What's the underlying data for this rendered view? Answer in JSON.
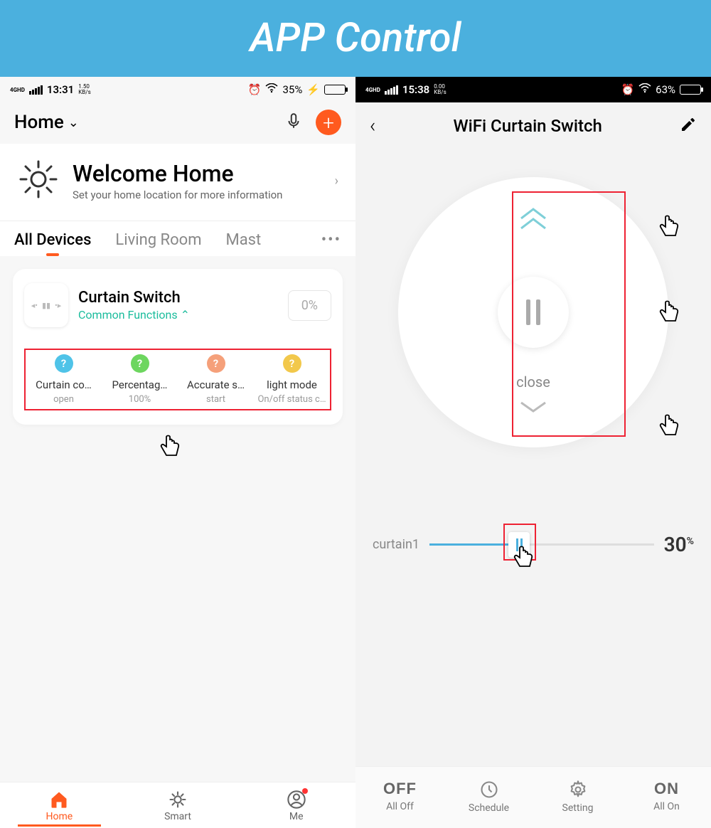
{
  "banner": "APP Control",
  "left": {
    "status": {
      "net": "4GHD",
      "time": "13:31",
      "kb": "1.50",
      "kbu": "KB/s",
      "battery_pct": "35%",
      "battery_fill": 35
    },
    "header": {
      "home": "Home",
      "chevron": "⌄"
    },
    "weather": {
      "title": "Welcome Home",
      "sub": "Set your home location for more information"
    },
    "tabs": {
      "t1": "All Devices",
      "t2": "Living Room",
      "t3": "Mast"
    },
    "card": {
      "title": "Curtain Switch",
      "cf": "Common Functions",
      "pct": "0%",
      "funcs": [
        {
          "label": "Curtain co…",
          "sub": "open",
          "color": "#4fc3e8"
        },
        {
          "label": "Percentag…",
          "sub": "100%",
          "color": "#6dd65f"
        },
        {
          "label": "Accurate s…",
          "sub": "start",
          "color": "#f5a07a"
        },
        {
          "label": "light mode",
          "sub": "On/off status c…",
          "color": "#f2c84b"
        }
      ]
    },
    "nav": {
      "home": "Home",
      "smart": "Smart",
      "me": "Me"
    }
  },
  "right": {
    "status": {
      "net": "4GHD",
      "time": "15:38",
      "kb": "0.00",
      "kbu": "KB/s",
      "battery_pct": "63%",
      "battery_fill": 63
    },
    "title": "WiFi Curtain Switch",
    "close": "close",
    "slider": {
      "label": "curtain1",
      "pct": "30",
      "pct_unit": "%",
      "position": 30
    },
    "bottom": {
      "off": "OFF",
      "off_sub": "All Off",
      "schedule": "Schedule",
      "setting": "Setting",
      "on": "ON",
      "on_sub": "All On"
    }
  }
}
